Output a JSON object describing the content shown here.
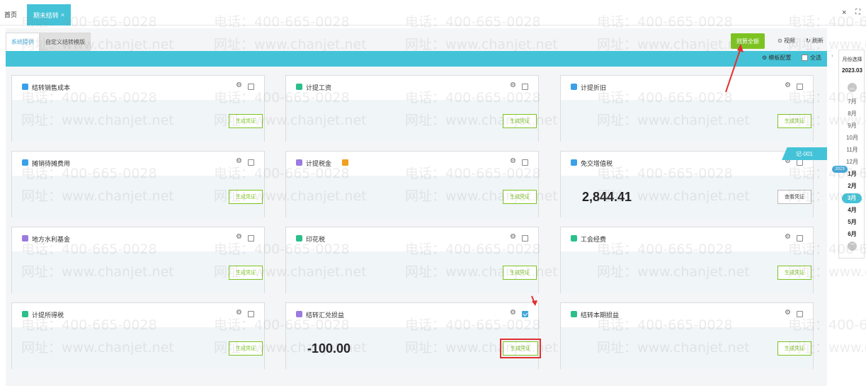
{
  "tabs": {
    "home": "首页",
    "active": "期末结转",
    "close": "×"
  },
  "window": {
    "close": "×",
    "fullscreen": "⛶"
  },
  "subtabs": {
    "system": "系统提供",
    "custom": "自定义结转模版"
  },
  "toolbar": {
    "settle_all": "则算全额",
    "video": "视频",
    "refresh": "刷新",
    "video_icon": "⊙",
    "refresh_icon": "↻"
  },
  "band": {
    "config": "模板配置",
    "config_icon": "⚙",
    "select_all": "全选"
  },
  "cards": [
    {
      "title": "结转销售成本",
      "button": "生成凭证",
      "icon_color": "#3aa0e8"
    },
    {
      "title": "计提工资",
      "button": "生成凭证",
      "icon_color": "#2bbf8a"
    },
    {
      "title": "计提折旧",
      "button": "生成凭证",
      "icon_color": "#3aa0e8"
    },
    {
      "title": "摊销待摊费用",
      "button": "生成凭证",
      "icon_color": "#3aa0e8"
    },
    {
      "title": "计提税金",
      "button": "生成凭证",
      "icon_color": "#9b7be0"
    },
    {
      "title": "免交增值税",
      "button": "查看凭证",
      "amount": "2,844.41",
      "ribbon": "记-001",
      "icon_color": "#3aa0e8"
    },
    {
      "title": "地方水利基金",
      "button": "生成凭证",
      "icon_color": "#9b7be0"
    },
    {
      "title": "印花税",
      "button": "生成凭证",
      "icon_color": "#2bbf8a"
    },
    {
      "title": "工会经费",
      "button": "生成凭证",
      "icon_color": "#2bbf8a"
    },
    {
      "title": "计提所得税",
      "button": "生成凭证",
      "icon_color": "#2bbf8a"
    },
    {
      "title": "结转汇兑损益",
      "button": "生成凭证",
      "amount": "-100.00",
      "icon_color": "#9b7be0"
    },
    {
      "title": "结转本期损益",
      "button": "生成凭证",
      "icon_color": "#2bbf8a"
    }
  ],
  "month_panel": {
    "title": "月份选择",
    "current": "2023.03",
    "year_tag": "2023",
    "months": [
      "7月",
      "8月",
      "9月",
      "10月",
      "11月",
      "12月",
      "1月",
      "2月",
      "3月",
      "4月",
      "5月",
      "6月"
    ],
    "selected": "3月",
    "up": "︿",
    "down": "﹀"
  },
  "watermark": {
    "phone": "电话：400-665-0028",
    "site": "网址：www.chanjet.net"
  },
  "colors": {
    "accent": "#44c3d8",
    "green": "#7cc322",
    "annotation": "#e03030"
  }
}
